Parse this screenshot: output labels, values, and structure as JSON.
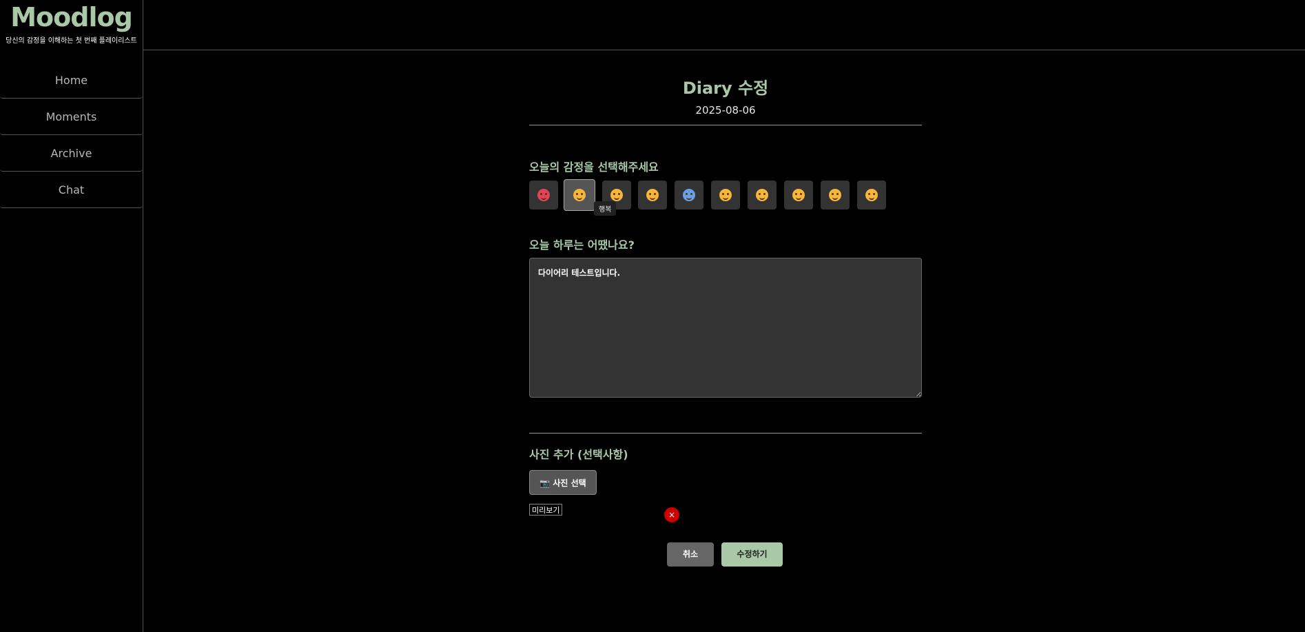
{
  "brand": {
    "title": "Moodlog",
    "subtitle": "당신의 감정을 이해하는 첫 번째 플레이리스트"
  },
  "nav": {
    "items": [
      {
        "label": "Home"
      },
      {
        "label": "Moments"
      },
      {
        "label": "Archive"
      },
      {
        "label": "Chat"
      }
    ]
  },
  "header": {
    "avatar_icon": "user-avatar-icon",
    "avatar_color": "#7a2ea0"
  },
  "page": {
    "title": "Diary 수정",
    "date": "2025-08-06"
  },
  "emotion_section": {
    "label": "오늘의 감정을 선택해주세요",
    "selected_index": 1,
    "tooltip": "행복",
    "emotions": [
      {
        "icon": "angry-face-icon",
        "color": "#e0455a"
      },
      {
        "icon": "smiling-face-icon",
        "color": "#f5b63b"
      },
      {
        "icon": "flushed-face-icon",
        "color": "#f5b63b"
      },
      {
        "icon": "hand-over-mouth-face-icon",
        "color": "#f5b63b"
      },
      {
        "icon": "screaming-face-icon",
        "color": "#6aa0e8"
      },
      {
        "icon": "frowning-face-icon",
        "color": "#f5b63b"
      },
      {
        "icon": "yawning-face-icon",
        "color": "#f5b63b"
      },
      {
        "icon": "pensive-face-icon",
        "color": "#f5b63b"
      },
      {
        "icon": "slightly-smiling-face-icon",
        "color": "#f5b63b"
      },
      {
        "icon": "zany-face-icon",
        "color": "#f5b63b"
      }
    ]
  },
  "diary_section": {
    "label": "오늘 하루는 어땠나요?",
    "content": "다이어리 테스트입니다."
  },
  "photo_section": {
    "label": "사진 추가 (선택사항)",
    "select_button": "📷 사진 선택",
    "preview_alt": "미리보기",
    "remove_label": "×"
  },
  "actions": {
    "cancel": "취소",
    "save": "수정하기"
  },
  "colors": {
    "accent": "#a8c8a8",
    "danger": "#cc0000"
  }
}
